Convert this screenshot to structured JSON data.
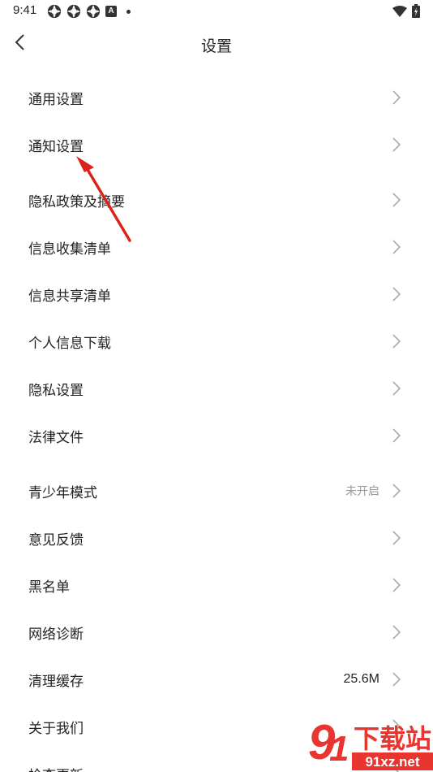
{
  "status_bar": {
    "time": "9:41",
    "a_label": "A"
  },
  "nav": {
    "title": "设置"
  },
  "settings": {
    "group1": [
      {
        "label": "通用设置"
      },
      {
        "label": "通知设置"
      },
      {
        "label": "隐私政策及摘要"
      },
      {
        "label": "信息收集清单"
      },
      {
        "label": "信息共享清单"
      },
      {
        "label": "个人信息下载"
      },
      {
        "label": "隐私设置"
      },
      {
        "label": "法律文件"
      }
    ],
    "group2": [
      {
        "label": "青少年模式",
        "value": "未开启"
      },
      {
        "label": "意见反馈"
      },
      {
        "label": "黑名单"
      },
      {
        "label": "网络诊断"
      },
      {
        "label": "清理缓存",
        "value": "25.6M"
      },
      {
        "label": "关于我们"
      },
      {
        "label": "检查更新"
      }
    ]
  },
  "watermark": {
    "text": "下载站",
    "domain": "91xz.net"
  },
  "colors": {
    "annotation_arrow": "#d9241c",
    "watermark_red": "#e8352f"
  }
}
